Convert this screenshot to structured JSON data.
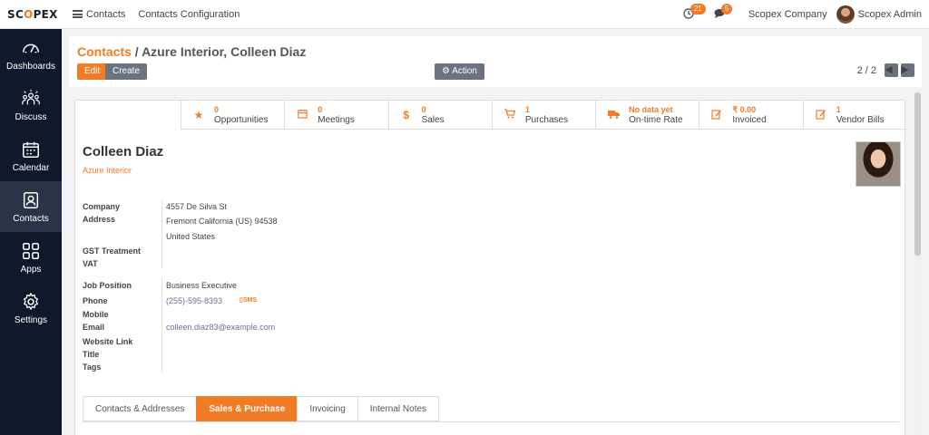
{
  "topbar": {
    "logo_prefix": "SC",
    "logo_o": "O",
    "logo_suffix": "PEX",
    "nav": [
      "Contacts",
      "Contacts Configuration"
    ],
    "activity_count": "21",
    "message_count": "5",
    "company": "Scopex Company",
    "user": "Scopex Admin"
  },
  "sidebar": {
    "items": [
      {
        "label": "Dashboards",
        "icon": "gauge-icon"
      },
      {
        "label": "Discuss",
        "icon": "people-icon"
      },
      {
        "label": "Calendar",
        "icon": "calendar-icon"
      },
      {
        "label": "Contacts",
        "icon": "contact-card-icon"
      },
      {
        "label": "Apps",
        "icon": "grid-icon"
      },
      {
        "label": "Settings",
        "icon": "gear-icon"
      }
    ],
    "active": "Contacts"
  },
  "control": {
    "breadcrumb_link": "Contacts",
    "breadcrumb_sep": " / ",
    "breadcrumb_current": "Azure Interior, Colleen Diaz",
    "edit_label": "Edit",
    "create_label": "Create",
    "action_label": "Action",
    "pager": "2 / 2"
  },
  "smart_buttons": [
    {
      "value": "0",
      "label": "Opportunities",
      "icon": "star-icon"
    },
    {
      "value": "0",
      "label": "Meetings",
      "icon": "calendar-icon"
    },
    {
      "value": "0",
      "label": "Sales",
      "icon": "dollar-icon"
    },
    {
      "value": "1",
      "label": "Purchases",
      "icon": "cart-icon"
    },
    {
      "value": "No data yet",
      "label": "On-time Rate",
      "icon": "truck-icon"
    },
    {
      "value": "₹ 0.00",
      "label": "Invoiced",
      "icon": "edit-icon"
    },
    {
      "value": "1",
      "label": "Vendor Bills",
      "icon": "edit-icon"
    }
  ],
  "contact": {
    "name": "Colleen Diaz",
    "company": "Azure Interior",
    "fields": {
      "company_label": "Company",
      "address_label": "Address",
      "street": "4557 De Silva St",
      "city_line": "Fremont  California (US)  94538",
      "country": "United States",
      "gst_label": "GST Treatment",
      "vat_label": "VAT",
      "job_label": "Job Position",
      "job_value": "Business Executive",
      "phone_label": "Phone",
      "phone_value": "(255)-595-8393",
      "sms_label": "SMS",
      "mobile_label": "Mobile",
      "email_label": "Email",
      "email_value": "colleen.diaz83@example.com",
      "website_label": "Website Link",
      "title_label": "Title",
      "tags_label": "Tags"
    }
  },
  "tabs": [
    {
      "label": "Contacts & Addresses",
      "active": false
    },
    {
      "label": "Sales & Purchase",
      "active": true
    },
    {
      "label": "Invoicing",
      "active": false
    },
    {
      "label": "Internal Notes",
      "active": false
    }
  ],
  "colors": {
    "accent": "#f07c25",
    "sidebar": "#10182b",
    "secondary_button": "#6b7280"
  }
}
